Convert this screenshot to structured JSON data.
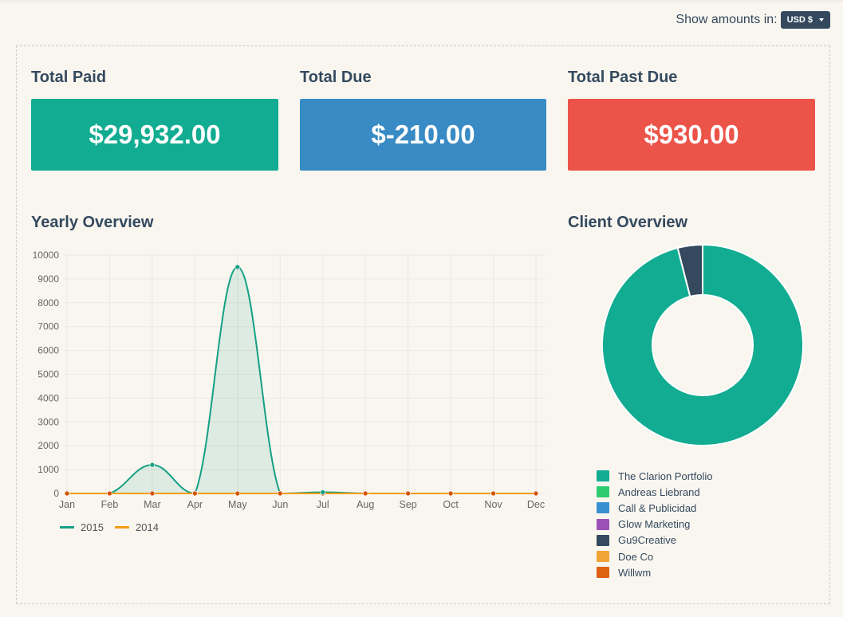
{
  "toolbar": {
    "show_amounts_label": "Show amounts in:",
    "currency": "USD $"
  },
  "totals": [
    {
      "label": "Total Paid",
      "value": "$29,932.00",
      "color": "#11ac91"
    },
    {
      "label": "Total Due",
      "value": "$-210.00",
      "color": "#388bc4"
    },
    {
      "label": "Total Past Due",
      "value": "$930.00",
      "color": "#ec5349"
    }
  ],
  "yearly": {
    "title": "Yearly Overview",
    "legend": [
      {
        "name": "2015",
        "color": "#16a085"
      },
      {
        "name": "2014",
        "color": "#f39c12"
      }
    ]
  },
  "client": {
    "title": "Client Overview",
    "items": [
      {
        "name": "The Clarion Portfolio",
        "color": "#11ac91"
      },
      {
        "name": "Andreas Liebrand",
        "color": "#2ecc71"
      },
      {
        "name": "Call & Publicidad",
        "color": "#3a8fd0"
      },
      {
        "name": "Glow Marketing",
        "color": "#9b50b8"
      },
      {
        "name": "Gu9Creative",
        "color": "#34495e"
      },
      {
        "name": "Doe Co",
        "color": "#f1a534"
      },
      {
        "name": "Willwm",
        "color": "#df6112"
      }
    ]
  },
  "chart_data": [
    {
      "type": "area",
      "categories": [
        "Jan",
        "Feb",
        "Mar",
        "Apr",
        "May",
        "Jun",
        "Jul",
        "Aug",
        "Sep",
        "Oct",
        "Nov",
        "Dec"
      ],
      "ylim": [
        0,
        10000
      ],
      "yticks": [
        0,
        1000,
        2000,
        3000,
        4000,
        5000,
        6000,
        7000,
        8000,
        9000,
        10000
      ],
      "series": [
        {
          "name": "2015",
          "values": [
            0,
            0,
            1200,
            0,
            9500,
            0,
            50,
            0,
            0,
            0,
            0,
            0
          ],
          "color": "#16a085"
        },
        {
          "name": "2014",
          "values": [
            0,
            0,
            0,
            0,
            0,
            0,
            0,
            0,
            0,
            0,
            0,
            0
          ],
          "color": "#f39c12"
        }
      ]
    },
    {
      "type": "pie",
      "labels": [
        "The Clarion Portfolio",
        "Andreas Liebrand",
        "Call & Publicidad",
        "Glow Marketing",
        "Gu9Creative",
        "Doe Co",
        "Willwm"
      ],
      "values": [
        96,
        0,
        0,
        0,
        4,
        0,
        0
      ]
    }
  ]
}
